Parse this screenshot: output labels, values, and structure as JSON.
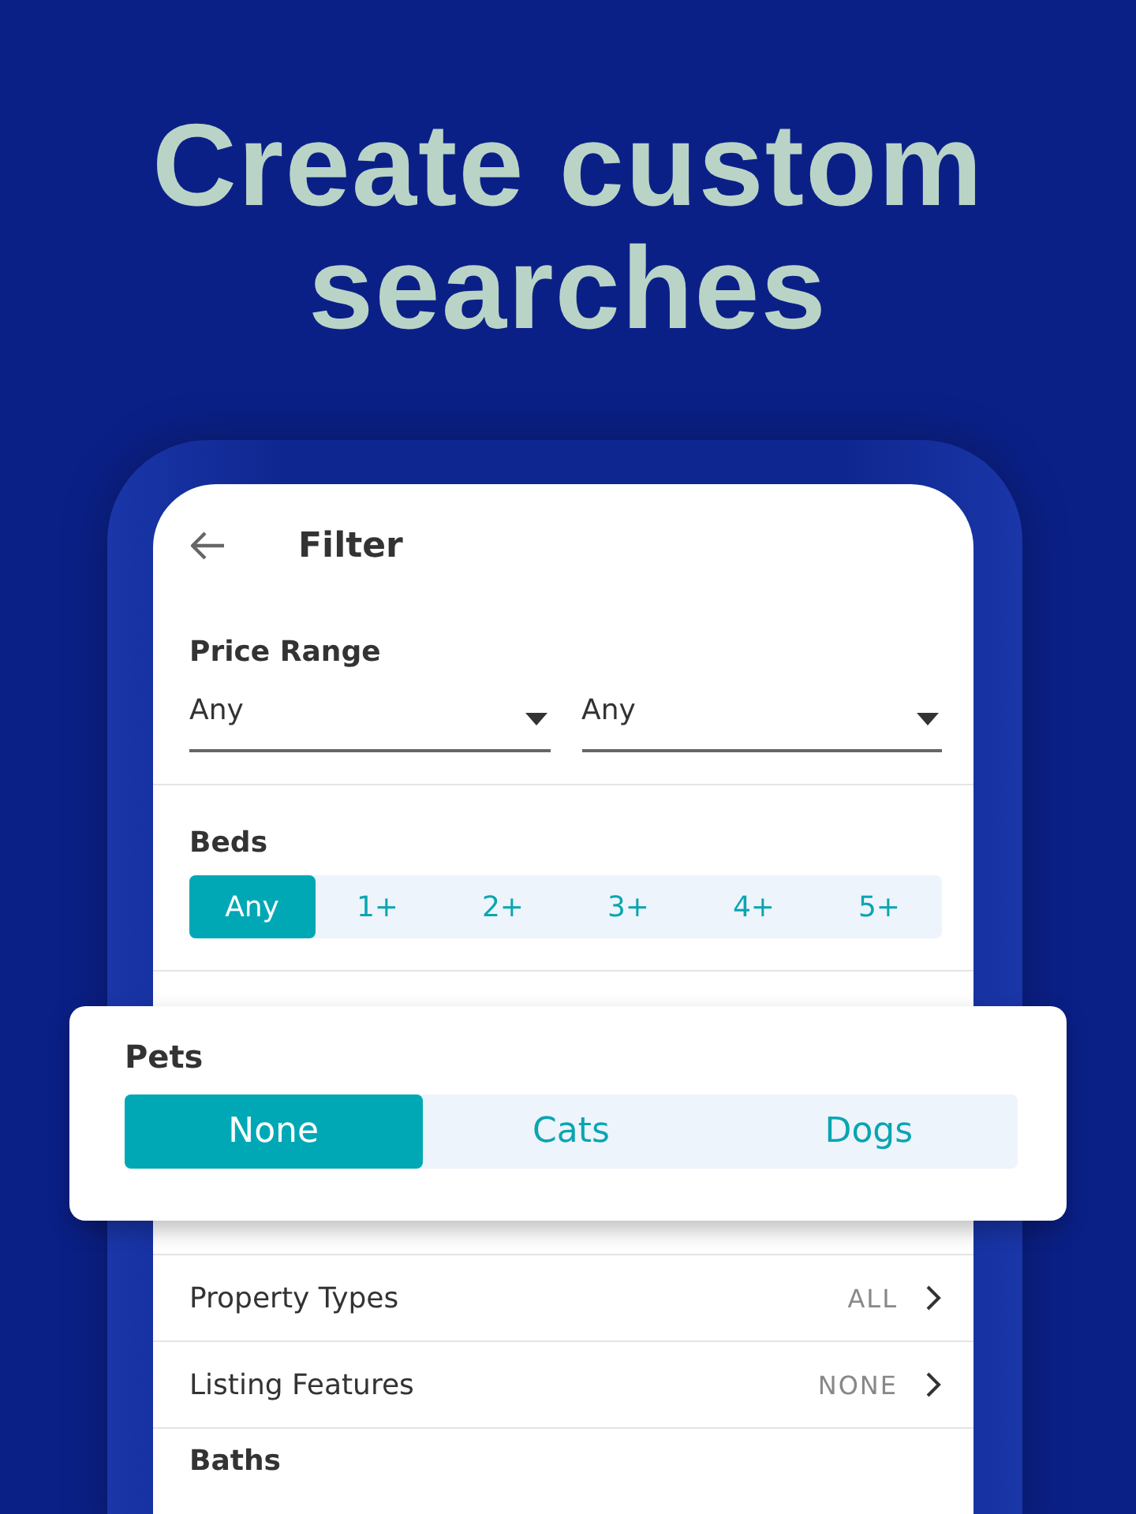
{
  "headline": "Create custom searches",
  "screen": {
    "title": "Filter",
    "price_range": {
      "label": "Price Range",
      "min": "Any",
      "max": "Any"
    },
    "beds": {
      "label": "Beds",
      "options": [
        {
          "label": "Any",
          "selected": true
        },
        {
          "label": "1+",
          "selected": false
        },
        {
          "label": "2+",
          "selected": false
        },
        {
          "label": "3+",
          "selected": false
        },
        {
          "label": "4+",
          "selected": false
        },
        {
          "label": "5+",
          "selected": false
        }
      ]
    },
    "pets": {
      "label": "Pets",
      "options": [
        {
          "label": "None",
          "selected": true
        },
        {
          "label": "Cats",
          "selected": false
        },
        {
          "label": "Dogs",
          "selected": false
        }
      ]
    },
    "rows": [
      {
        "label": "Property Types",
        "value": "ALL"
      },
      {
        "label": "Listing Features",
        "value": "NONE"
      }
    ],
    "baths": {
      "label": "Baths"
    }
  }
}
